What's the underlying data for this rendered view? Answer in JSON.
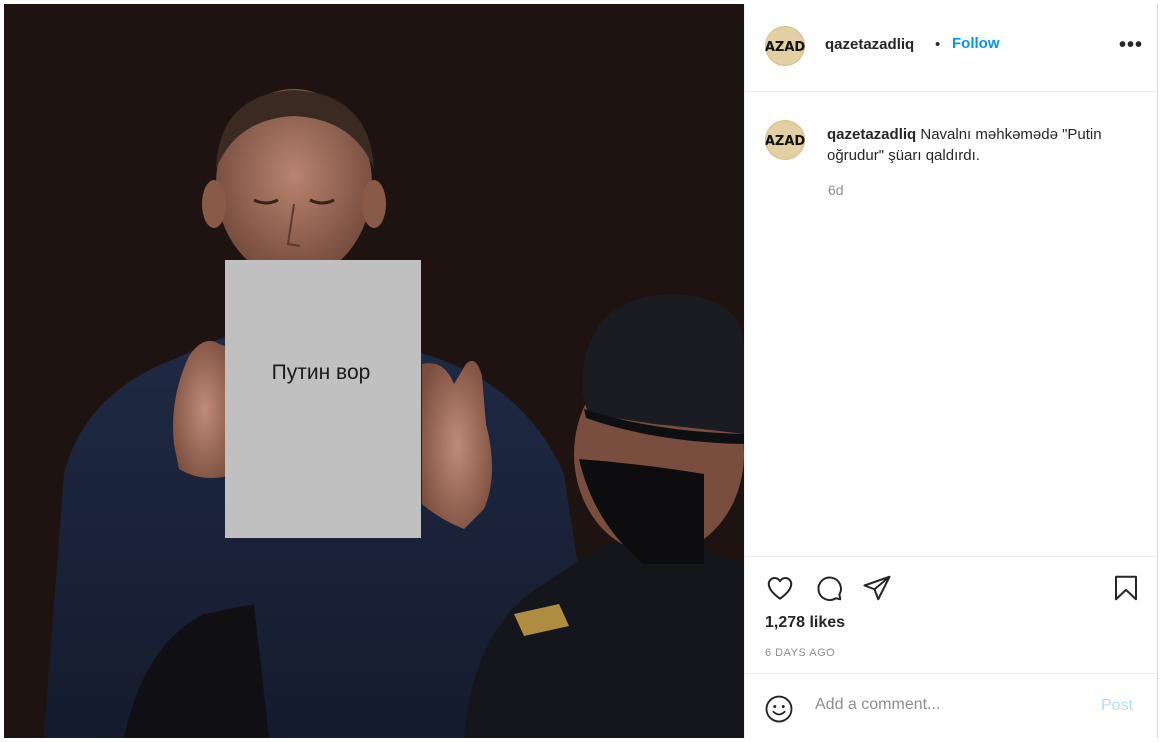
{
  "post": {
    "username": "qazetazadliq",
    "follow_label": "Follow",
    "more_label": "•••",
    "separator": "•",
    "avatar_text": "AZAD",
    "photo_sign_text": "Путин вор",
    "caption": {
      "username": "qazetazadliq",
      "text": "Navalnı məhkəmədə \"Putin oğrudur\" şüarı qaldırdı.",
      "time": "6d"
    },
    "likes": "1,278 likes",
    "time_ago": "6 DAYS AGO",
    "comment": {
      "placeholder": "Add a comment...",
      "post_label": "Post"
    }
  },
  "colors": {
    "accent": "#0095f6",
    "post_disabled": "#b2dffc",
    "muted": "#8e8e8e",
    "text": "#262626"
  },
  "icons": [
    "heart-icon",
    "comment-icon",
    "share-icon",
    "bookmark-icon",
    "emoji-icon",
    "more-icon"
  ]
}
